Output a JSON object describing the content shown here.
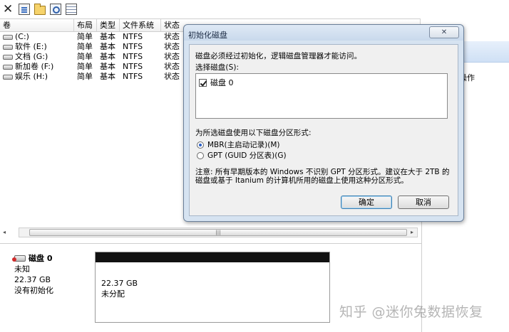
{
  "toolbar": {
    "icons": [
      "close-icon",
      "properties-icon",
      "folder-icon",
      "zoom-icon",
      "disk-list-icon"
    ],
    "close_glyph": "✕"
  },
  "volumes": {
    "headers": [
      "卷",
      "布局",
      "类型",
      "文件系统",
      "状态"
    ],
    "rows": [
      {
        "name": "(C:)",
        "layout": "简单",
        "type": "基本",
        "fs": "NTFS",
        "status": "状态"
      },
      {
        "name": "软件 (E:)",
        "layout": "简单",
        "type": "基本",
        "fs": "NTFS",
        "status": "状态"
      },
      {
        "name": "文档 (G:)",
        "layout": "简单",
        "type": "基本",
        "fs": "NTFS",
        "status": "状态"
      },
      {
        "name": "新加卷 (F:)",
        "layout": "简单",
        "type": "基本",
        "fs": "NTFS",
        "status": "状态"
      },
      {
        "name": "娱乐 (H:)",
        "layout": "简单",
        "type": "基本",
        "fs": "NTFS",
        "status": "状态"
      }
    ]
  },
  "scrollbar": {
    "thumb_glyph": "|||"
  },
  "right_pane": {
    "action_label": "操作"
  },
  "disk": {
    "title": "磁盘 0",
    "kind": "未知",
    "size": "22.37 GB",
    "state": "没有初始化",
    "partition_size": "22.37 GB",
    "partition_state": "未分配"
  },
  "dialog": {
    "title": "初始化磁盘",
    "close_label": "✕",
    "intro": "磁盘必须经过初始化，逻辑磁盘管理器才能访问。",
    "select_label": "选择磁盘(S):",
    "disk_item": "磁盘 0",
    "partition_label": "为所选磁盘使用以下磁盘分区形式:",
    "mbr_label": "MBR(主启动记录)(M)",
    "gpt_label": "GPT (GUID 分区表)(G)",
    "note": "注意: 所有早期版本的 Windows 不识别 GPT 分区形式。建议在大于 2TB 的磁盘或基于 Itanium 的计算机所用的磁盘上使用这种分区形式。",
    "ok_label": "确定",
    "cancel_label": "取消"
  },
  "watermark": "知乎 @迷你兔数据恢复"
}
